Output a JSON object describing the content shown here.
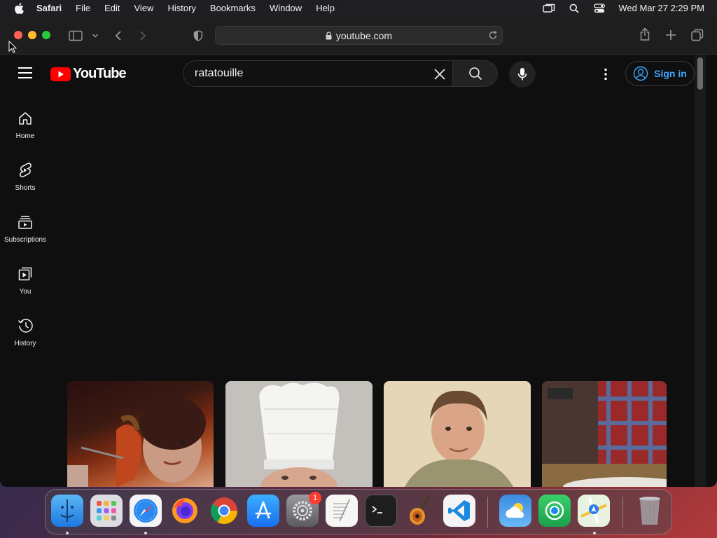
{
  "menubar": {
    "app_name": "Safari",
    "items": [
      "File",
      "Edit",
      "View",
      "History",
      "Bookmarks",
      "Window",
      "Help"
    ],
    "datetime": "Wed Mar 27  2:29 PM"
  },
  "browser": {
    "url": "youtube.com"
  },
  "youtube": {
    "logo_text": "YouTube",
    "search": {
      "value": "ratatouille"
    },
    "signin_label": "Sign in",
    "sidebar": [
      {
        "label": "Home",
        "icon": "home-icon"
      },
      {
        "label": "Shorts",
        "icon": "shorts-icon"
      },
      {
        "label": "Subscriptions",
        "icon": "subscriptions-icon"
      },
      {
        "label": "You",
        "icon": "you-icon"
      },
      {
        "label": "History",
        "icon": "history-icon"
      }
    ]
  },
  "dock": {
    "system_settings_badge": "1",
    "apps": [
      "finder",
      "launchpad",
      "safari",
      "firefox",
      "chrome",
      "app-store",
      "system-settings",
      "textedit",
      "terminal",
      "garageband",
      "vscode",
      "weather",
      "find-my",
      "maps",
      "trash"
    ]
  },
  "colors": {
    "yt_background": "#0f0f0f",
    "yt_red": "#ff0000",
    "signin_blue": "#3ea6ff"
  }
}
